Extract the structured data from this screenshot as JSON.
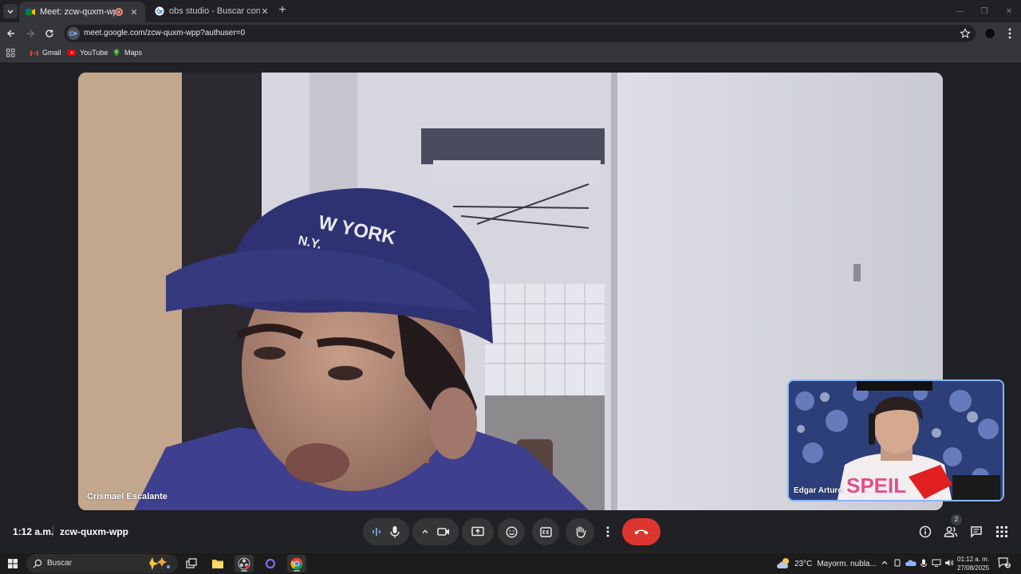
{
  "browser": {
    "tabs": [
      {
        "title": "Meet: zcw-quxm-wpp",
        "active": true
      },
      {
        "title": "obs studio - Buscar con Google",
        "active": false
      }
    ],
    "url": "meet.google.com/zcw-quxm-wpp?authuser=0",
    "bookmarks": [
      {
        "label": "Gmail",
        "icon": "gmail-icon"
      },
      {
        "label": "YouTube",
        "icon": "youtube-icon"
      },
      {
        "label": "Maps",
        "icon": "maps-icon"
      }
    ]
  },
  "meet": {
    "main_participant": "Crismael Escalante",
    "self_participant": "Edgar Arturo",
    "time": "1:12 a.m.",
    "meeting_code": "zcw-quxm-wpp",
    "people_count": "2",
    "cap_text": "W YORK",
    "cap_text2": "N.Y.",
    "shirt_text": "SPEIL"
  },
  "taskbar": {
    "search_placeholder": "Buscar",
    "weather_temp": "23°C",
    "weather_desc": "Mayorm. nubla...",
    "clock_time": "01:12 a. m.",
    "clock_date": "27/08/2025",
    "notification_count": "2"
  },
  "colors": {
    "accent": "#8ab4f8",
    "hangup": "#dc362e",
    "background": "#202124"
  }
}
